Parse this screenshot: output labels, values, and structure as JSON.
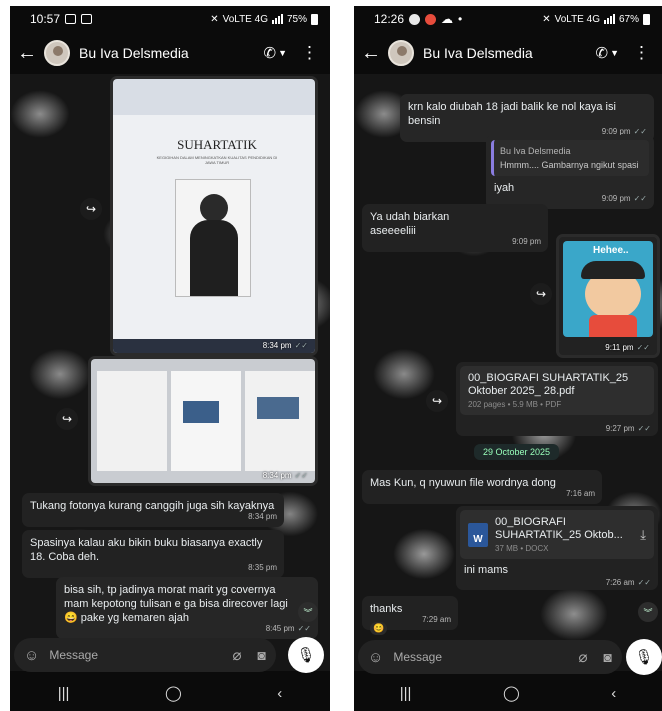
{
  "left": {
    "status": {
      "time": "10:57",
      "network": "VoLTE 4G",
      "battery": "75%"
    },
    "contact": "Bu Iva Delsmedia",
    "doc_title": "SUHARTATIK",
    "doc_subtitle": "KEGIGIHAN DALAM MENINGKATKAN KUALITAS PENDIDIKAN DI JAWA TIMUR",
    "photo1_time": "8:34 pm",
    "photo2_time": "8:34 pm",
    "messages": [
      {
        "text": "Tukang fotonya kurang canggih juga sih kayaknya",
        "time": "8:34 pm"
      },
      {
        "text": "Spasinya kalau aku bikin buku biasanya exactly 18. Coba deh.",
        "time": "8:35 pm"
      },
      {
        "text": "bisa sih, tp jadinya morat marit yg covernya mam kepotong tulisan e ga bisa direcover lagi 😄 pake yg kemaren ajah",
        "time": "8:45 pm"
      }
    ],
    "input_placeholder": "Message"
  },
  "right": {
    "status": {
      "time": "12:26",
      "network": "VoLTE 4G",
      "battery": "67%"
    },
    "contact": "Bu Iva Delsmedia",
    "msg1": {
      "text": "krn kalo diubah 18 jadi balik ke nol kaya isi bensin",
      "time": "9:09 pm"
    },
    "msg2": {
      "reply_name": "Bu Iva Delsmedia",
      "reply_text": "Hmmm.... Gambarnya ngikut spasi",
      "text": "iyah",
      "time": "9:09 pm"
    },
    "msg3": {
      "text": "Ya udah biarkan aseeeeliii",
      "time": "9:09 pm"
    },
    "sticker": {
      "caption": "Hehee..",
      "time": "9:11 pm"
    },
    "pdf": {
      "name": "00_BIOGRAFI SUHARTATIK_25 Oktober 2025_ 28.pdf",
      "info": "202 pages • 5.9 MB • PDF",
      "time": "9:27 pm"
    },
    "date_chip": "29 October 2025",
    "msg4": {
      "text": "Mas Kun, q nyuwun file wordnya dong",
      "time": "7:16 am"
    },
    "docx": {
      "name": "00_BIOGRAFI SUHARTATIK_25 Oktob...",
      "info": "37 MB • DOCX",
      "text": "ini mams",
      "time": "7:26 am"
    },
    "msg5": {
      "text": "thanks",
      "time": "7:29 am"
    },
    "input_placeholder": "Message"
  }
}
